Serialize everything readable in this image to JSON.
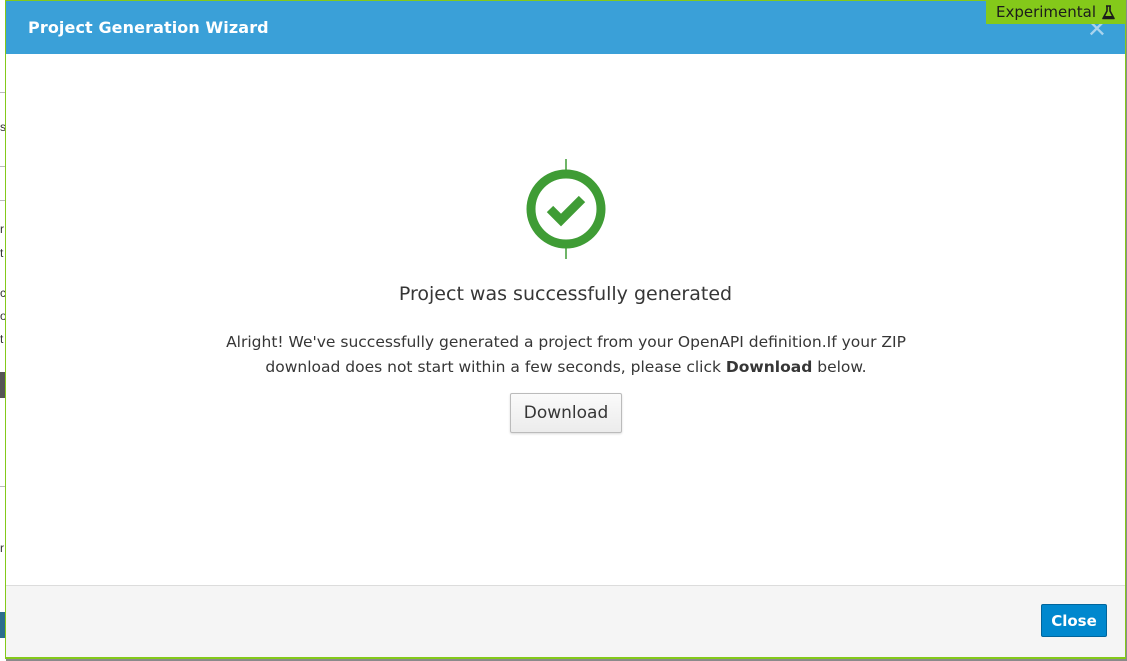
{
  "modal": {
    "title": "Project Generation Wizard",
    "close_icon": "close-icon"
  },
  "badge": {
    "label": "Experimental",
    "icon": "flask-icon"
  },
  "content": {
    "status_icon": "check-circle-icon",
    "heading": "Project was successfully generated",
    "message_part1": "Alright! We've successfully generated a project from your OpenAPI definition.If your ZIP download does not start within a few seconds, please click ",
    "message_bold": "Download",
    "message_part2": " below.",
    "download_label": "Download"
  },
  "footer": {
    "close_label": "Close"
  },
  "colors": {
    "header": "#3aa0d8",
    "badge": "#84c91a",
    "success": "#3f9c35",
    "primary_button": "#0088ce"
  }
}
